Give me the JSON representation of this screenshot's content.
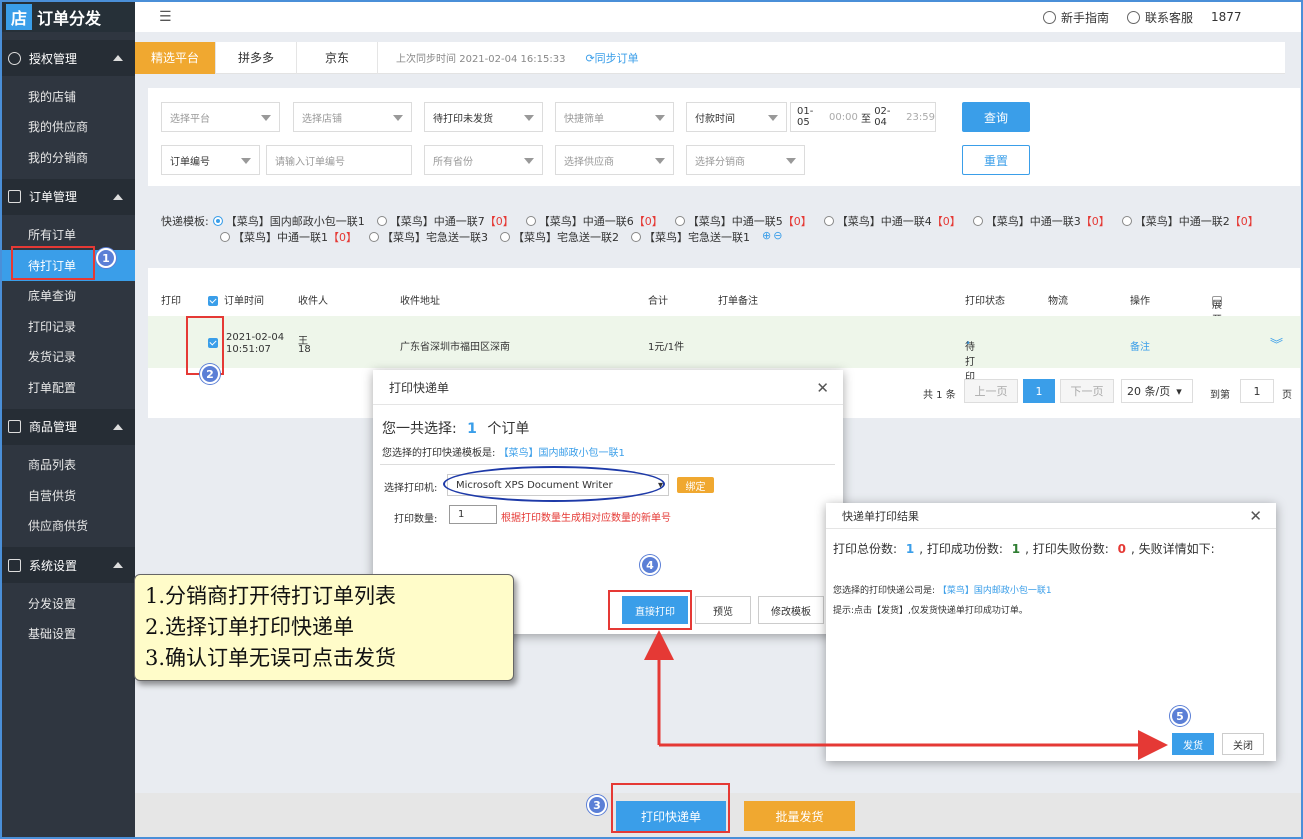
{
  "app": {
    "logo_char": "店",
    "title": "订单分发"
  },
  "topbar": {
    "menu_icon": "☰",
    "guide": "新手指南",
    "service": "联系客服",
    "user": "1877"
  },
  "sidebar": {
    "groups": [
      {
        "label": "授权管理",
        "items": [
          "我的店铺",
          "我的供应商",
          "我的分销商"
        ]
      },
      {
        "label": "订单管理",
        "items": [
          "所有订单",
          "待打订单",
          "底单查询",
          "打印记录",
          "发货记录",
          "打单配置"
        ]
      },
      {
        "label": "商品管理",
        "items": [
          "商品列表",
          "自营供货",
          "供应商供货"
        ]
      },
      {
        "label": "系统设置",
        "items": [
          "分发设置",
          "基础设置"
        ]
      }
    ]
  },
  "tabs": {
    "items": [
      "精选平台",
      "拼多多",
      "京东"
    ],
    "sync_time": "上次同步时间 2021-02-04 16:15:33",
    "sync_button": "同步订单"
  },
  "filters": {
    "platform": "选择平台",
    "shop": "选择店铺",
    "status": "待打印未发货",
    "quick": "快捷筛单",
    "time_type": "付款时间",
    "date_from": "01-05",
    "time_from": "00:00",
    "to": "至",
    "date_to": "02-04",
    "time_to": "23:59",
    "order_no_type": "订单编号",
    "order_no_placeholder": "请输入订单编号",
    "province": "所有省份",
    "supplier": "选择供应商",
    "distributor": "选择分销商",
    "query": "查询",
    "reset": "重置"
  },
  "template": {
    "label": "快递模板:",
    "row1": [
      {
        "name": "【菜鸟】国内邮政小包一联1",
        "count": "",
        "selected": true
      },
      {
        "name": "【菜鸟】中通一联7",
        "count": "【0】"
      },
      {
        "name": "【菜鸟】中通一联6",
        "count": "【0】"
      },
      {
        "name": "【菜鸟】中通一联5",
        "count": "【0】"
      },
      {
        "name": "【菜鸟】中通一联4",
        "count": "【0】"
      },
      {
        "name": "【菜鸟】中通一联3",
        "count": "【0】"
      },
      {
        "name": "【菜鸟】中通一联2",
        "count": "【0】"
      }
    ],
    "row2": [
      {
        "name": "【菜鸟】中通一联1",
        "count": "【0】"
      },
      {
        "name": "【菜鸟】宅急送一联3",
        "count": ""
      },
      {
        "name": "【菜鸟】宅急送一联2",
        "count": ""
      },
      {
        "name": "【菜鸟】宅急送一联1",
        "count": ""
      }
    ]
  },
  "table": {
    "headers": {
      "print": "打印",
      "time": "订单时间",
      "receiver": "收件人",
      "address": "收件地址",
      "total": "合计",
      "note": "打单备注",
      "status": "打印状态",
      "logistics": "物流",
      "action": "操作",
      "expand": "展开详情"
    },
    "row": {
      "date": "2021-02-04",
      "time": "10:51:07",
      "name": "王",
      "phone": "18",
      "address": "广东省深圳市福田区深南",
      "total": "1元/1件",
      "status": "待打印",
      "action": "备注"
    },
    "pager": {
      "total": "共 1 条",
      "prev": "上一页",
      "page": "1",
      "next": "下一页",
      "size": "20 条/页",
      "goto": "到第",
      "goto_value": "1",
      "goto_unit": "页"
    }
  },
  "print_dialog": {
    "title": "打印快递单",
    "selected_prefix": "您一共选择:",
    "selected_count": "1",
    "selected_suffix": "个订单",
    "template_prefix": "您选择的打印快递模板是:",
    "template_name": "【菜鸟】国内邮政小包一联1",
    "printer_label": "选择打印机:",
    "printer_value": "Microsoft XPS Document Writer",
    "bind": "绑定",
    "qty_label": "打印数量:",
    "qty_value": "1",
    "qty_hint": "根据打印数量生成相对应数量的新单号",
    "direct_print": "直接打印",
    "preview": "预览",
    "edit_template": "修改模板"
  },
  "result_dialog": {
    "title": "快递单打印结果",
    "total_label": "打印总份数:",
    "total": "1",
    "ok_label": "打印成功份数:",
    "ok": "1",
    "fail_label": "打印失败份数:",
    "fail": "0",
    "detail": "失败详情如下:",
    "company_prefix": "您选择的打印快递公司是:",
    "company": "【菜鸟】国内邮政小包一联1",
    "tip": "提示:点击【发货】,仅发货快递单打印成功订单。",
    "ship": "发货",
    "close": "关闭"
  },
  "bottom": {
    "print_button": "打印快递单",
    "batch_ship": "批量发货"
  },
  "callout": {
    "line1": "1.分销商打开待打订单列表",
    "line2": "2.选择订单打印快递单",
    "line3": "3.确认订单无误可点击发货"
  },
  "steps": [
    "1",
    "2",
    "3",
    "4",
    "5"
  ],
  "colors": {
    "accent": "#3a9ee9",
    "orange": "#f0a830",
    "sidebar": "#2f3640",
    "highlight": "#e53935"
  }
}
